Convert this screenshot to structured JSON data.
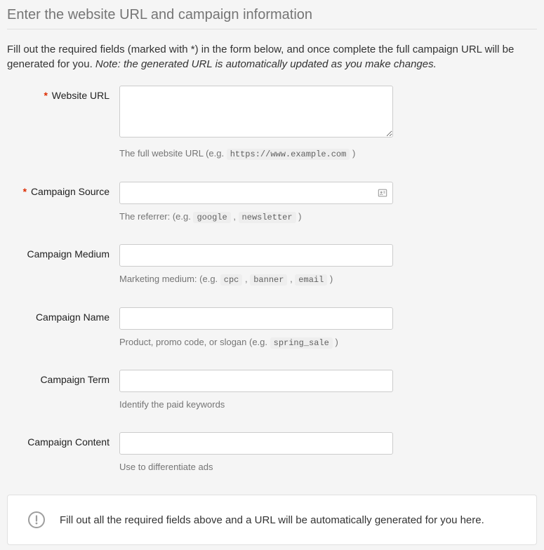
{
  "page": {
    "title": "Enter the website URL and campaign information",
    "intro_prefix": "Fill out the required fields (marked with *) in the form below, and once complete the full campaign URL will be generated for you. ",
    "intro_note": "Note: the generated URL is automatically updated as you make changes."
  },
  "fields": {
    "website_url": {
      "label": "Website URL",
      "required": true,
      "value": "",
      "help_prefix": "The full website URL (e.g. ",
      "help_code": "https://www.example.com",
      "help_suffix": " )"
    },
    "campaign_source": {
      "label": "Campaign Source",
      "required": true,
      "value": "",
      "help_prefix": "The referrer: (e.g. ",
      "help_code1": "google",
      "help_sep": " , ",
      "help_code2": "newsletter",
      "help_suffix": " )"
    },
    "campaign_medium": {
      "label": "Campaign Medium",
      "required": false,
      "value": "",
      "help_prefix": "Marketing medium: (e.g. ",
      "help_code1": "cpc",
      "help_code2": "banner",
      "help_code3": "email",
      "help_sep": " , ",
      "help_suffix": " )"
    },
    "campaign_name": {
      "label": "Campaign Name",
      "required": false,
      "value": "",
      "help_prefix": "Product, promo code, or slogan (e.g. ",
      "help_code": "spring_sale",
      "help_suffix": " )"
    },
    "campaign_term": {
      "label": "Campaign Term",
      "required": false,
      "value": "",
      "help": "Identify the paid keywords"
    },
    "campaign_content": {
      "label": "Campaign Content",
      "required": false,
      "value": "",
      "help": "Use to differentiate ads"
    }
  },
  "result": {
    "message": "Fill out all the required fields above and a URL will be automatically generated for you here."
  }
}
